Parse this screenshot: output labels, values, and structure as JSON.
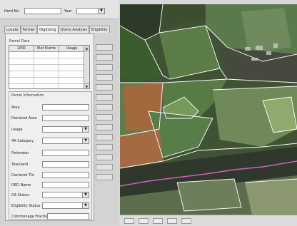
{
  "header": {
    "herd_label": "Herd No",
    "herd_value": "",
    "year_label": "Year",
    "year_value": ""
  },
  "tabs": [
    {
      "label": "Locate"
    },
    {
      "label": "Farmer"
    },
    {
      "label": "Digitizing",
      "active": true
    },
    {
      "label": "Query Analysis"
    },
    {
      "label": "Eligibility"
    }
  ],
  "parcel_data": {
    "title": "Parcel Data",
    "columns": [
      "LPID",
      "Plot Numb",
      "Usage"
    ],
    "rows": [
      [
        "",
        "",
        ""
      ],
      [
        "",
        "",
        ""
      ],
      [
        "",
        "",
        ""
      ],
      [
        "",
        "",
        ""
      ],
      [
        "",
        "",
        ""
      ],
      [
        "",
        "",
        ""
      ]
    ]
  },
  "parcel_info": {
    "title": "Parcel Information",
    "fields": [
      {
        "label": "Area",
        "value": "",
        "dropdown": false
      },
      {
        "label": "Declared Area",
        "value": "",
        "dropdown": false
      },
      {
        "label": "Usage",
        "value": "",
        "dropdown": true
      },
      {
        "label": "4A Category",
        "value": "",
        "dropdown": true
      },
      {
        "label": "Perimeter",
        "value": "",
        "dropdown": false
      },
      {
        "label": "Townland",
        "value": "",
        "dropdown": false
      },
      {
        "label": "Declared Tld",
        "value": "",
        "dropdown": false
      },
      {
        "label": "DED Name",
        "value": "",
        "dropdown": false
      },
      {
        "label": "DA Status",
        "value": "",
        "dropdown": true
      },
      {
        "label": "Eligibility Status",
        "value": "",
        "dropdown": true
      },
      {
        "label": "Commonage Fraction",
        "value": "",
        "dropdown": false
      }
    ]
  },
  "icons": {
    "dropdown": "chevron-down-icon",
    "scroll_up": "arrow-up-icon",
    "scroll_down": "arrow-down-icon"
  },
  "colors": {
    "panel_bg": "#d3d3d3",
    "parcel_outline": "#ffffff",
    "river_line": "#d060c0"
  },
  "map_toolbar": {
    "buttons": [
      "",
      "",
      "",
      "",
      ""
    ]
  }
}
